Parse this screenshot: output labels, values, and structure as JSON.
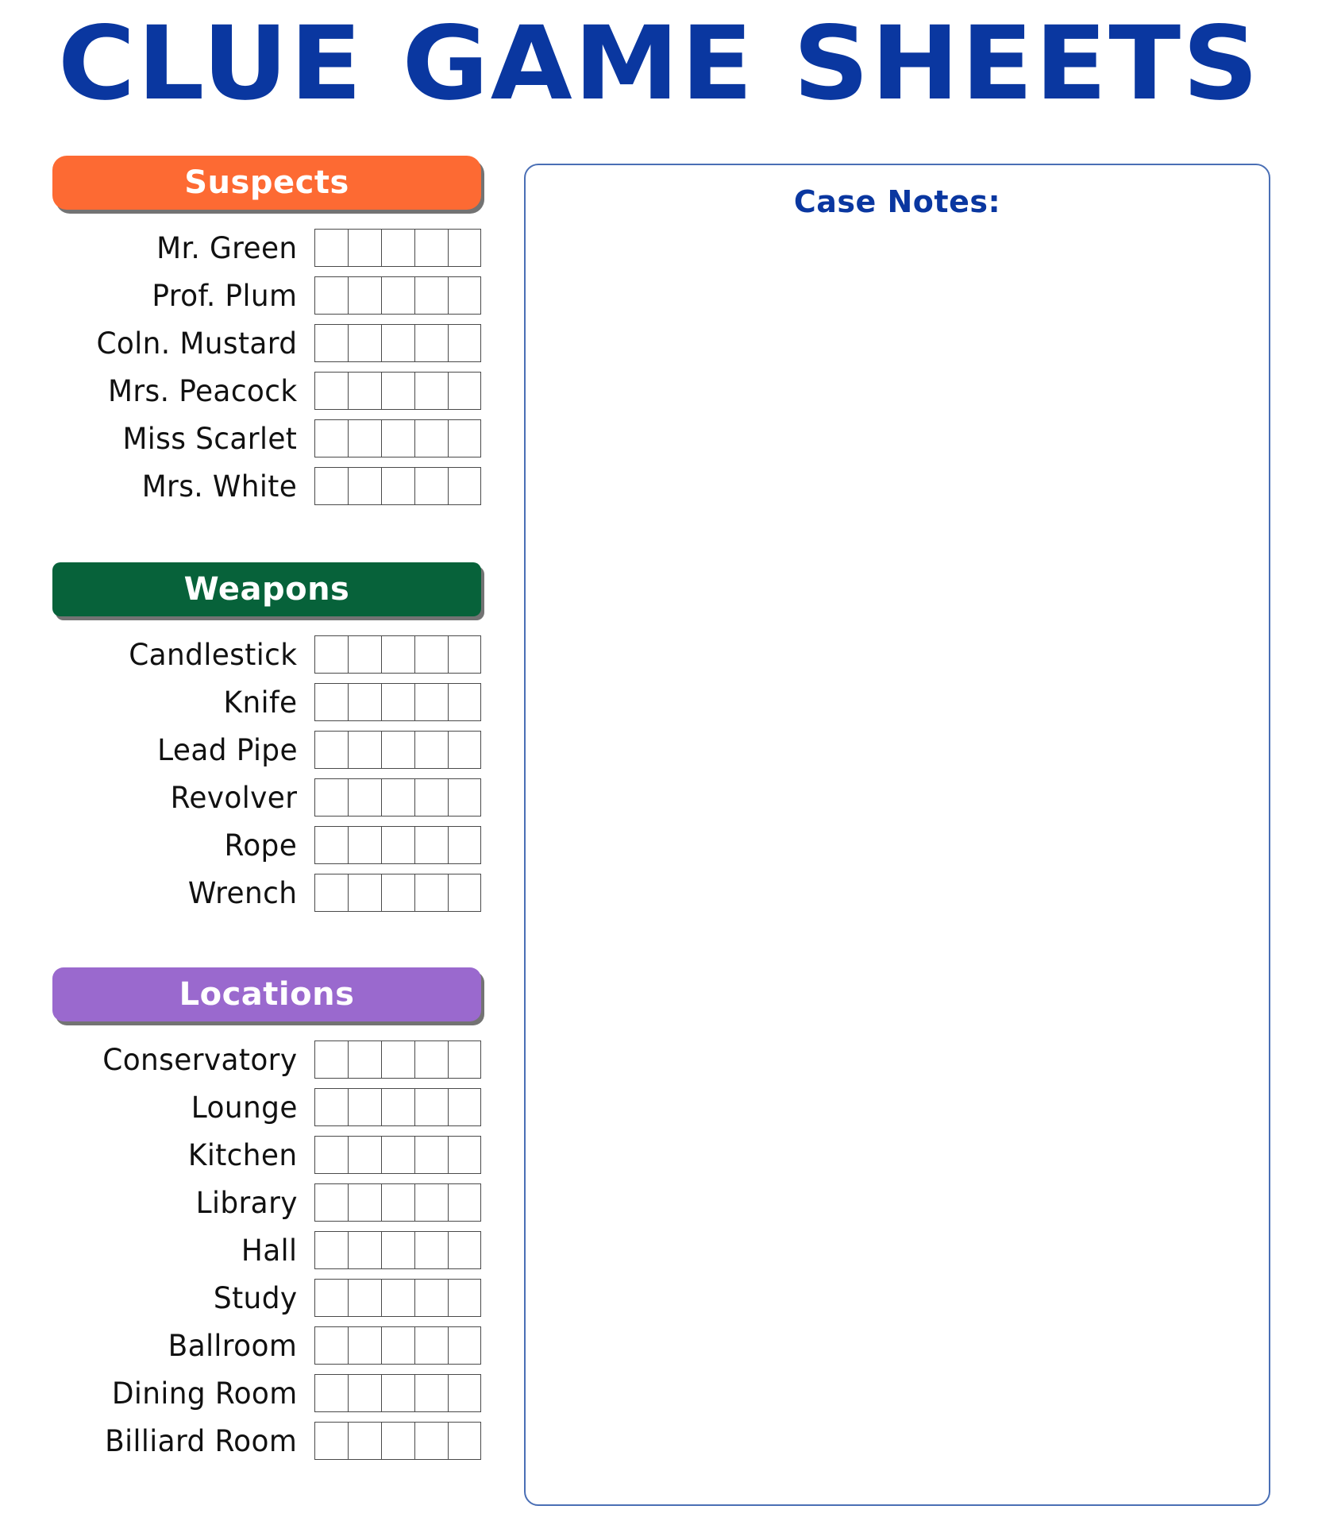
{
  "page": {
    "title": "CLUE GAME SHEETS",
    "title_color": "#0A37A0",
    "background": "#ffffff"
  },
  "sections": [
    {
      "key": "suspects",
      "label": "Suspects",
      "color": "#FD6A33",
      "checkbox_columns": 5,
      "items": [
        "Mr. Green",
        "Prof. Plum",
        "Coln. Mustard",
        "Mrs. Peacock",
        "Miss Scarlet",
        "Mrs. White"
      ]
    },
    {
      "key": "weapons",
      "label": "Weapons",
      "color": "#07623A",
      "checkbox_columns": 5,
      "items": [
        "Candlestick",
        "Knife",
        "Lead Pipe",
        "Revolver",
        "Rope",
        "Wrench"
      ]
    },
    {
      "key": "locations",
      "label": "Locations",
      "color": "#9A69CE",
      "checkbox_columns": 5,
      "items": [
        "Conservatory",
        "Lounge",
        "Kitchen",
        "Library",
        "Hall",
        "Study",
        "Ballroom",
        "Dining Room",
        "Billiard Room"
      ]
    }
  ],
  "case_notes": {
    "title": "Case Notes:",
    "title_color": "#0A37A0",
    "border_color": "#4a6fb5",
    "value": ""
  }
}
